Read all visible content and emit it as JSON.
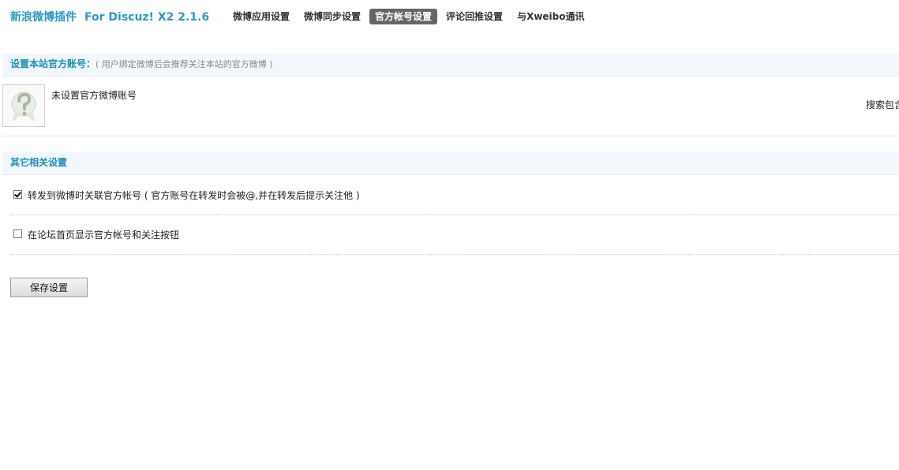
{
  "header": {
    "title": "新浪微博插件",
    "version": "For Discuz! X2 2.1.6",
    "tabs": [
      {
        "label": "微博应用设置",
        "active": false
      },
      {
        "label": "微博同步设置",
        "active": false
      },
      {
        "label": "官方帐号设置",
        "active": true
      },
      {
        "label": "评论回推设置",
        "active": false
      },
      {
        "label": "与Xweibo通讯",
        "active": false
      }
    ]
  },
  "official_account": {
    "heading": "设置本站官方账号：",
    "hint": "( 用户绑定微博后会推荐关注本站的官方微博 )",
    "avatar_icon": "question-mark-avatar-icon",
    "status_text": "未设置官方微博账号",
    "search_link": "搜索包含"
  },
  "other_settings": {
    "heading": "其它相关设置",
    "options": [
      {
        "label": "转发到微博时关联官方帐号 ( 官方账号在转发时会被@,并在转发后提示关注他 )",
        "checked": true
      },
      {
        "label": "在论坛首页显示官方帐号和关注按钮",
        "checked": false
      }
    ]
  },
  "save_button": {
    "label": "保存设置"
  },
  "colors": {
    "accent": "#2a9ac5",
    "active_tab_bg": "#666666",
    "section_bg": "#f2f7fc"
  }
}
